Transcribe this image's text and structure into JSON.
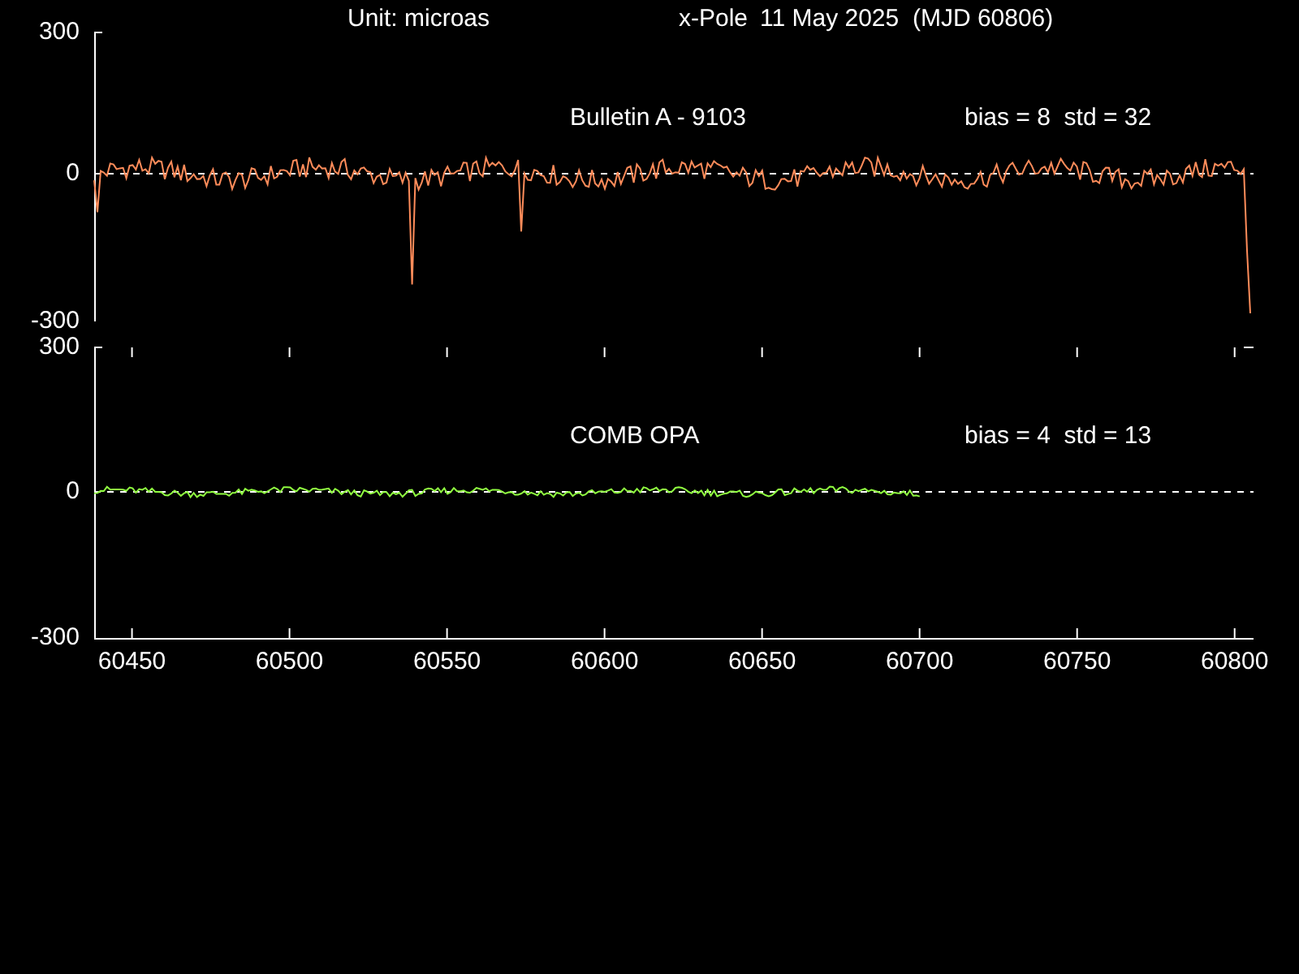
{
  "header": {
    "unit": "Unit: microas",
    "component": "x-Pole",
    "date": "11 May 2025  (MJD 60806)"
  },
  "panels": [
    {
      "label": "Bulletin A - 9103",
      "stats": "bias = 8  std = 32",
      "color": "#ff8c5a",
      "yticks": [
        "300",
        "0",
        "-300"
      ]
    },
    {
      "label": "COMB OPA",
      "stats": "bias = 4  std = 13",
      "color": "#90ff40",
      "yticks": [
        "300",
        "0",
        "-300"
      ]
    }
  ],
  "xticks": [
    "60450",
    "60500",
    "60550",
    "60600",
    "60650",
    "60700",
    "60750",
    "60800"
  ]
}
